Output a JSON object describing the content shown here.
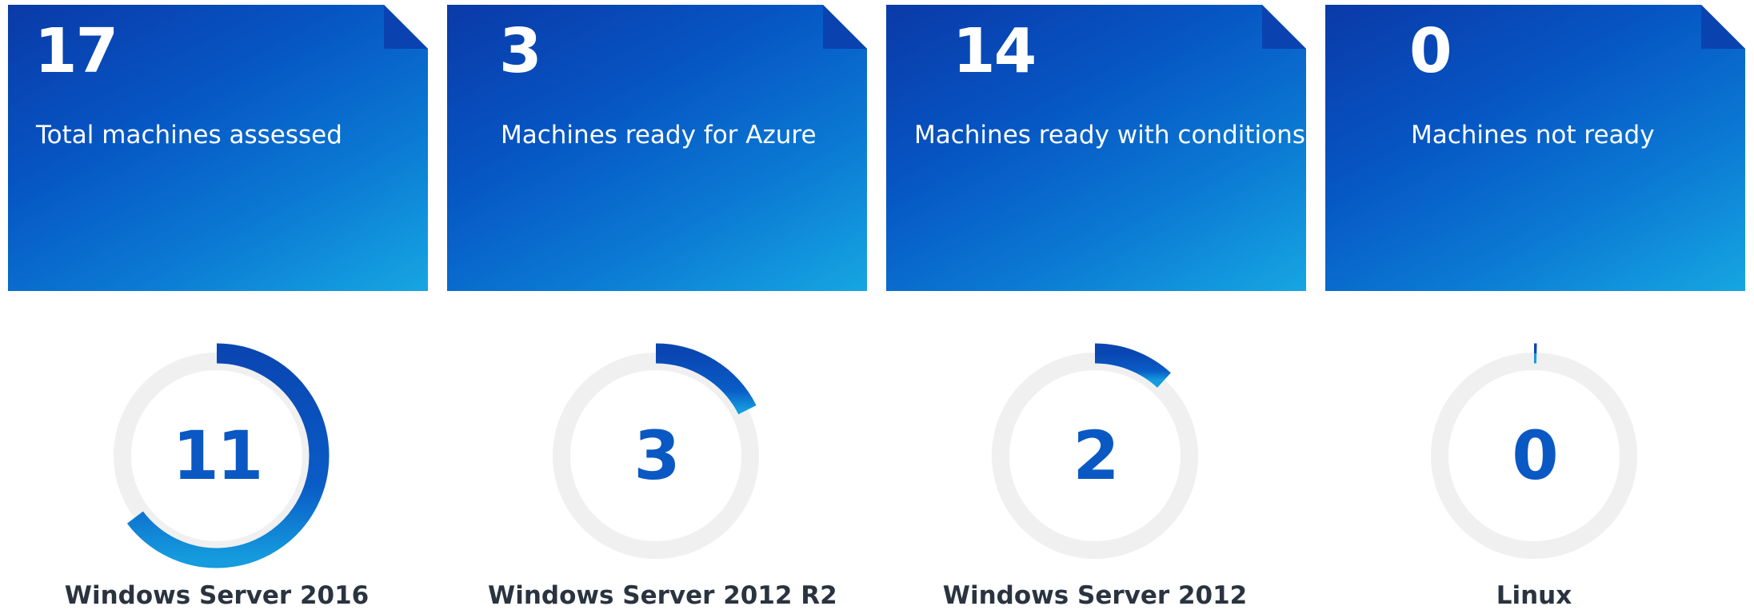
{
  "summary_cards": [
    {
      "value": "17",
      "label": "Total machines assessed"
    },
    {
      "value": "3",
      "label": "Machines ready for Azure"
    },
    {
      "value": "14",
      "label": "Machines ready with conditions"
    },
    {
      "value": "0",
      "label": "Machines not ready"
    }
  ],
  "os_breakdown": [
    {
      "value": "11",
      "label": "Windows Server 2016",
      "fraction": 0.647
    },
    {
      "value": "3",
      "label": "Windows Server 2012 R2",
      "fraction": 0.176
    },
    {
      "value": "2",
      "label": "Windows Server 2012",
      "fraction": 0.118
    },
    {
      "value": "0",
      "label": "Linux",
      "fraction": 0.0
    }
  ],
  "colors": {
    "card_gradient_start": "#0a3aa8",
    "card_gradient_end": "#16a6e2",
    "donut_track": "#f0f0f0",
    "donut_value": "#0a58c4",
    "os_label": "#2a3440"
  }
}
